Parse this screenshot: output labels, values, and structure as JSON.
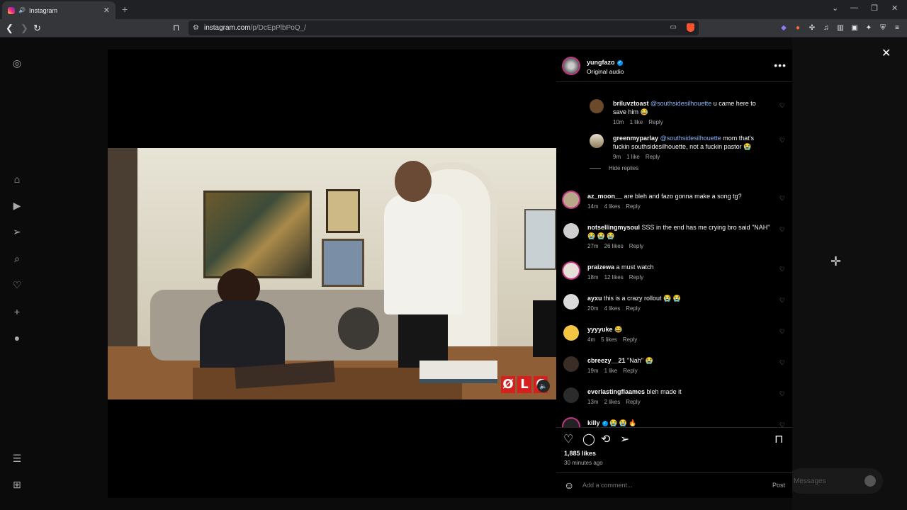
{
  "browser": {
    "tab_title": "Instagram",
    "url_host": "instagram.com",
    "url_path": "/p/DcEpPlbPoQ_/"
  },
  "video": {
    "logo_letters": [
      "Ø",
      "L",
      "C"
    ]
  },
  "post": {
    "author": "yungfazo",
    "audio": "Original audio",
    "likes": "1,885 likes",
    "time": "30 minutes ago",
    "comment_placeholder": "Add a comment...",
    "post_label": "Post",
    "hide_replies": "Hide replies"
  },
  "comments": [
    {
      "user": "briluvztoast",
      "mention": "@southsidesilhouette",
      "text": " u came here to save him 😂",
      "time": "10m",
      "likes": "1 like",
      "reply": "Reply"
    },
    {
      "user": "greenmyparlay",
      "mention": "@southsidesilhouette",
      "text": " mom that's fuckin southsidesilhouette, not a fuckin pastor 😭",
      "time": "9m",
      "likes": "1 like",
      "reply": "Reply"
    },
    {
      "user": "az_moon__",
      "text": " are bleh and fazo gonna make a song tg?",
      "time": "14m",
      "likes": "4 likes",
      "reply": "Reply"
    },
    {
      "user": "notsellingmysoul",
      "text": " SSS in the end has me crying bro said \"NAH\" 😭 😭 😭",
      "time": "27m",
      "likes": "26 likes",
      "reply": "Reply"
    },
    {
      "user": "praizewa",
      "text": " a must watch",
      "time": "18m",
      "likes": "12 likes",
      "reply": "Reply"
    },
    {
      "user": "ayxu",
      "text": " this is a crazy rollout 😭 😭",
      "time": "20m",
      "likes": "4 likes",
      "reply": "Reply"
    },
    {
      "user": "yyyyuke",
      "text": " 😂",
      "time": "4m",
      "likes": "5 likes",
      "reply": "Reply"
    },
    {
      "user": "cbreezy__21",
      "text": " \"Nah\" 😭",
      "time": "19m",
      "likes": "1 like",
      "reply": "Reply"
    },
    {
      "user": "everlastingflaames",
      "text": " bleh made it",
      "time": "13m",
      "likes": "2 likes",
      "reply": "Reply"
    },
    {
      "user": "killy",
      "text": " 😭 😭 🔥",
      "time": "",
      "likes": "",
      "reply": ""
    }
  ],
  "overlay": {
    "messages": "Messages"
  },
  "colors": {
    "verified": "#0095f6",
    "mention": "#8ab4f8",
    "story_ring": "#c13584"
  }
}
